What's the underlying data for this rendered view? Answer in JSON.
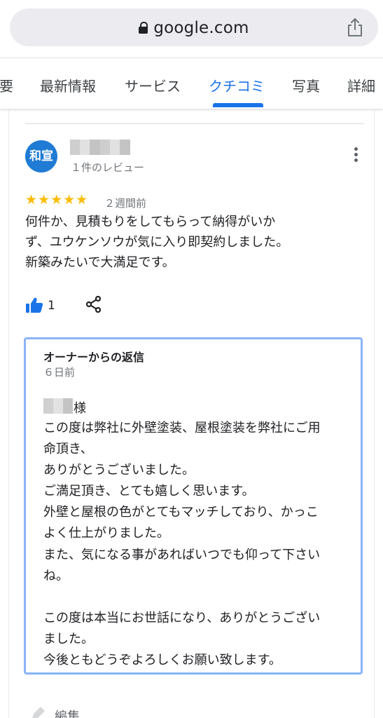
{
  "browser": {
    "url": "google.com",
    "icons": {
      "lock": "lock-icon",
      "share": "share-icon"
    }
  },
  "tabs": [
    {
      "label": "要",
      "active": false
    },
    {
      "label": "最新情報",
      "active": false
    },
    {
      "label": "サービス",
      "active": false
    },
    {
      "label": "クチコミ",
      "active": true
    },
    {
      "label": "写真",
      "active": false
    },
    {
      "label": "詳細",
      "active": false
    }
  ],
  "accent_color": "#1a73e8",
  "review": {
    "avatar_text": "和宣",
    "avatar_color": "#1f7bd4",
    "review_count": "１件のレビュー",
    "stars": "★★★★★",
    "rating": 5,
    "star_color": "#fbbc04",
    "time_ago": "２週間前",
    "text_lines": [
      "何件か、見積もりをしてもらって納得がいか",
      "ず、ユウケンソウが気に入り即契約しました。",
      "新築みたいで大満足です。"
    ],
    "like_count": "1",
    "icons": {
      "like": "thumbs-up-icon",
      "share": "share-icon",
      "more": "more-vert-icon"
    }
  },
  "owner_reply": {
    "title": "オーナーからの返信",
    "date": "６日前",
    "salutation_suffix": "様",
    "lines": [
      "この度は弊社に外壁塗装、屋根塗装を弊社にご用",
      "命頂き、",
      "ありがとうございました。",
      "ご満足頂き、とても嬉しく思います。",
      "外壁と屋根の色がとてもマッチしており、かっこ",
      "よく仕上がりました。",
      "また、気になる事があればいつでも仰って下さい",
      "ね。",
      "",
      "この度は本当にお世話になり、ありがとうござい",
      "ました。",
      "今後ともどうぞよろしくお願い致します。"
    ],
    "border_color": "#8ab4f8"
  },
  "footer": {
    "edit_label": "編集",
    "icon": "pencil-icon"
  }
}
